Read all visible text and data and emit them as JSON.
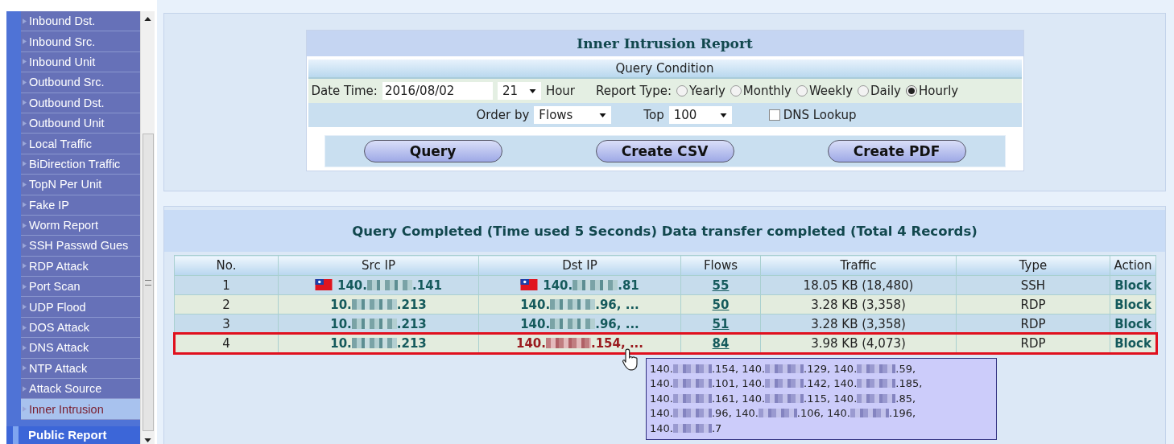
{
  "sidebar": {
    "items": [
      {
        "label": "Inbound Dst.",
        "selected": false
      },
      {
        "label": "Inbound Src.",
        "selected": false
      },
      {
        "label": "Inbound Unit",
        "selected": false
      },
      {
        "label": "Outbound Src.",
        "selected": false
      },
      {
        "label": "Outbound Dst.",
        "selected": false
      },
      {
        "label": "Outbound Unit",
        "selected": false
      },
      {
        "label": "Local Traffic",
        "selected": false
      },
      {
        "label": "BiDirection Traffic",
        "selected": false
      },
      {
        "label": "TopN Per Unit",
        "selected": false
      },
      {
        "label": "Fake IP",
        "selected": false
      },
      {
        "label": "Worm Report",
        "selected": false
      },
      {
        "label": "SSH Passwd Gues",
        "selected": false
      },
      {
        "label": "RDP Attack",
        "selected": false
      },
      {
        "label": "Port Scan",
        "selected": false
      },
      {
        "label": "UDP Flood",
        "selected": false
      },
      {
        "label": "DOS Attack",
        "selected": false
      },
      {
        "label": "DNS Attack",
        "selected": false
      },
      {
        "label": "NTP Attack",
        "selected": false
      },
      {
        "label": "Attack Source",
        "selected": false
      },
      {
        "label": "Inner Intrusion",
        "selected": true
      }
    ],
    "section": "Public Report"
  },
  "report": {
    "title": "Inner Intrusion Report",
    "condition_title": "Query Condition",
    "date_label": "Date Time:",
    "date_value": "2016/08/02",
    "hour_value": "21",
    "hour_label": "Hour",
    "report_type_label": "Report Type:",
    "report_types": [
      {
        "label": "Yearly",
        "selected": false
      },
      {
        "label": "Monthly",
        "selected": false
      },
      {
        "label": "Weekly",
        "selected": false
      },
      {
        "label": "Daily",
        "selected": false
      },
      {
        "label": "Hourly",
        "selected": true
      }
    ],
    "order_label": "Order by",
    "order_value": "Flows",
    "top_label": "Top",
    "top_value": "100",
    "dns_lookup": {
      "label": "DNS Lookup",
      "checked": false
    },
    "buttons": [
      "Query",
      "Create CSV",
      "Create PDF"
    ]
  },
  "results": {
    "title": "Query Completed (Time used 5 Seconds) Data transfer completed (Total 4 Records)",
    "columns": [
      "No.",
      "Src IP",
      "Dst IP",
      "Flows",
      "Traffic",
      "Type",
      "Action"
    ],
    "rows": [
      {
        "no": "1",
        "src_flag": true,
        "src": [
          {
            "kind": "text",
            "text": "140."
          },
          {
            "kind": "blur"
          },
          {
            "kind": "text",
            "text": ".141"
          }
        ],
        "dst_flag": true,
        "dst": [
          {
            "kind": "text",
            "text": "140."
          },
          {
            "kind": "blur"
          },
          {
            "kind": "text",
            "text": ".81"
          }
        ],
        "flows": "55",
        "traffic": "18.05 KB (18,480)",
        "type": "SSH",
        "action": "Block",
        "highlighted": false
      },
      {
        "no": "2",
        "src_flag": false,
        "src": [
          {
            "kind": "text",
            "text": "10."
          },
          {
            "kind": "blur"
          },
          {
            "kind": "text",
            "text": ".213"
          }
        ],
        "dst_flag": false,
        "dst": [
          {
            "kind": "text",
            "text": "140."
          },
          {
            "kind": "blur"
          },
          {
            "kind": "text",
            "text": ".96, ..."
          }
        ],
        "flows": "50",
        "traffic": "3.28 KB (3,358)",
        "type": "RDP",
        "action": "Block",
        "highlighted": false
      },
      {
        "no": "3",
        "src_flag": false,
        "src": [
          {
            "kind": "text",
            "text": "10."
          },
          {
            "kind": "blur"
          },
          {
            "kind": "text",
            "text": ".213"
          }
        ],
        "dst_flag": false,
        "dst": [
          {
            "kind": "text",
            "text": "140."
          },
          {
            "kind": "blur"
          },
          {
            "kind": "text",
            "text": ".96, ..."
          }
        ],
        "flows": "51",
        "traffic": "3.28 KB (3,358)",
        "type": "RDP",
        "action": "Block",
        "highlighted": false
      },
      {
        "no": "4",
        "src_flag": false,
        "src": [
          {
            "kind": "text",
            "text": "10."
          },
          {
            "kind": "blur"
          },
          {
            "kind": "text",
            "text": ".213"
          }
        ],
        "dst_flag": false,
        "dst": [
          {
            "kind": "text",
            "text": "140."
          },
          {
            "kind": "blur"
          },
          {
            "kind": "text",
            "text": ".154, ..."
          }
        ],
        "flows": "84",
        "traffic": "3.98 KB (4,073)",
        "type": "RDP",
        "action": "Block",
        "highlighted": true
      }
    ],
    "tooltip": [
      [
        {
          "kind": "text",
          "text": "140."
        },
        {
          "kind": "blur"
        },
        {
          "kind": "text",
          "text": ".154, 140."
        },
        {
          "kind": "blur"
        },
        {
          "kind": "text",
          "text": ".129, 140."
        },
        {
          "kind": "blur"
        },
        {
          "kind": "text",
          "text": ".59,"
        }
      ],
      [
        {
          "kind": "text",
          "text": "140."
        },
        {
          "kind": "blur"
        },
        {
          "kind": "text",
          "text": ".101, 140."
        },
        {
          "kind": "blur"
        },
        {
          "kind": "text",
          "text": ".142, 140."
        },
        {
          "kind": "blur"
        },
        {
          "kind": "text",
          "text": ".185,"
        }
      ],
      [
        {
          "kind": "text",
          "text": "140."
        },
        {
          "kind": "blur"
        },
        {
          "kind": "text",
          "text": ".161, 140."
        },
        {
          "kind": "blur"
        },
        {
          "kind": "text",
          "text": ".115, 140."
        },
        {
          "kind": "blur"
        },
        {
          "kind": "text",
          "text": ".85,"
        }
      ],
      [
        {
          "kind": "text",
          "text": "140."
        },
        {
          "kind": "blur"
        },
        {
          "kind": "text",
          "text": ".96, 140."
        },
        {
          "kind": "blur"
        },
        {
          "kind": "text",
          "text": ".106, 140."
        },
        {
          "kind": "blur"
        },
        {
          "kind": "text",
          "text": ".196,"
        }
      ],
      [
        {
          "kind": "text",
          "text": "140."
        },
        {
          "kind": "blur"
        },
        {
          "kind": "text",
          "text": ".7"
        }
      ]
    ]
  }
}
